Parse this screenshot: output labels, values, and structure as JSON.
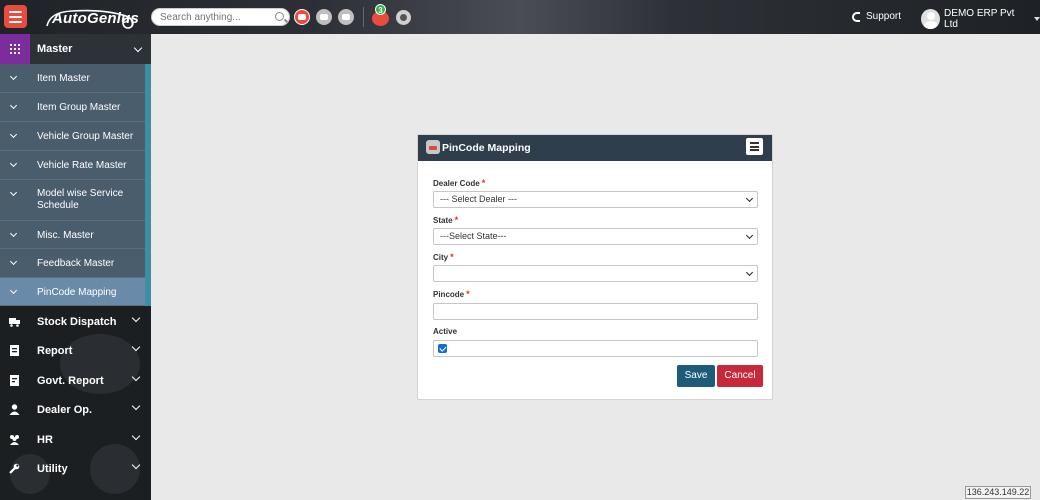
{
  "topbar": {
    "logo_text": "AutoGenius",
    "search_placeholder": "Search anything...",
    "notification_count": "3",
    "support_label": "Support",
    "user_name": "DEMO ERP Pvt Ltd"
  },
  "sidebar": {
    "master_label": "Master",
    "sub_items": [
      {
        "label": "Item Master"
      },
      {
        "label": "Item Group Master"
      },
      {
        "label": "Vehicle Group Master"
      },
      {
        "label": "Vehicle Rate Master"
      },
      {
        "label": "Model wise Service Schedule"
      },
      {
        "label": "Misc. Master"
      },
      {
        "label": "Feedback Master"
      },
      {
        "label": "PinCode Mapping"
      }
    ],
    "main_items": [
      {
        "label": "Stock Dispatch"
      },
      {
        "label": "Report"
      },
      {
        "label": "Govt. Report"
      },
      {
        "label": "Dealer Op."
      },
      {
        "label": "HR"
      },
      {
        "label": "Utility"
      }
    ]
  },
  "form": {
    "title": "PinCode Mapping",
    "dealer_code_label": "Dealer Code",
    "dealer_code_value": "--- Select Dealer ---",
    "state_label": "State",
    "state_value": "---Select State---",
    "city_label": "City",
    "city_value": "",
    "pincode_label": "Pincode",
    "pincode_value": "",
    "active_label": "Active",
    "active_checked": true,
    "required_mark": "*",
    "save_label": "Save",
    "cancel_label": "Cancel"
  },
  "footer": {
    "ip_address": "136.243.149.22"
  },
  "colors": {
    "accent_red": "#e94b3c",
    "master_purple": "#7d2c9d",
    "card_header": "#2f3e4d",
    "save_blue": "#1d5b7a",
    "cancel_red": "#c7283a"
  }
}
